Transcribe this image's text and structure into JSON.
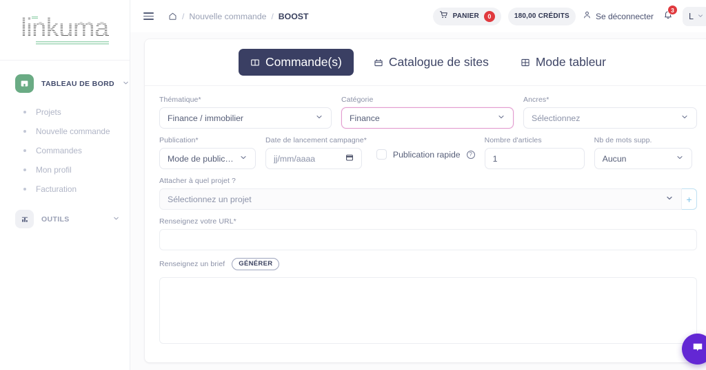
{
  "sidebar": {
    "logo_text": "linkuma",
    "groups": [
      {
        "label": "TABLEAU DE BORD",
        "icon": "dashboard-icon",
        "items": [
          {
            "label": "Projets"
          },
          {
            "label": "Nouvelle commande"
          },
          {
            "label": "Commandes"
          },
          {
            "label": "Mon profil"
          },
          {
            "label": "Facturation"
          }
        ]
      },
      {
        "label": "OUTILS",
        "icon": "tools-icon",
        "items": []
      }
    ]
  },
  "topbar": {
    "menu_icon": "hamburger-icon",
    "breadcrumb": {
      "home_icon": "home-icon",
      "sep": "/",
      "parent": "Nouvelle commande",
      "current": "BOOST"
    },
    "cart": {
      "label": "PANIER",
      "icon": "cart-icon",
      "count": "0"
    },
    "credits": "180,00 CRÉDITS",
    "logout": {
      "label": "Se déconnecter",
      "icon": "user-icon"
    },
    "notifications": {
      "icon": "bell-icon",
      "count": "3"
    },
    "avatar": {
      "letter": "L",
      "caret_icon": "chevron-down-icon"
    }
  },
  "tabs": [
    {
      "label": "Commande(s)",
      "icon": "orders-icon",
      "active": true
    },
    {
      "label": "Catalogue de sites",
      "icon": "catalog-icon",
      "active": false
    },
    {
      "label": "Mode tableur",
      "icon": "grid-icon",
      "active": false
    }
  ],
  "form": {
    "thematique": {
      "label": "Thématique*",
      "value": "Finance / immobilier"
    },
    "categorie": {
      "label": "Catégorie",
      "value": "Finance",
      "focused": true
    },
    "ancres": {
      "label": "Ancres*",
      "value": "Sélectionnez"
    },
    "publication": {
      "label": "Publication*",
      "value": "Mode de publication"
    },
    "date_campagne": {
      "label": "Date de lancement campagne*",
      "placeholder": "jj/mm/aaaa",
      "value": "",
      "icon": "calendar-icon"
    },
    "publication_rapide": {
      "label": "Publication rapide",
      "checked": false,
      "info_icon": "info-icon"
    },
    "nombre_articles": {
      "label": "Nombre d'articles",
      "value": "1"
    },
    "mots_supp": {
      "label": "Nb de mots supp.",
      "value": "Aucun"
    },
    "projet": {
      "label": "Attacher à quel projet ?",
      "placeholder": "Sélectionnez un projet",
      "add_label": "+"
    },
    "url": {
      "label": "Renseignez votre URL*",
      "value": ""
    },
    "brief": {
      "label": "Renseignez un brief",
      "generate_label": "GÉNÉRER",
      "value": ""
    }
  },
  "chat": {
    "icon": "chat-bubble-icon"
  },
  "colors": {
    "accent_navy": "#3a3f63",
    "green": "#6aab84",
    "focus_pink": "#e39dd0",
    "badge_red": "#e0393e",
    "chat_purple": "#6327d4"
  }
}
